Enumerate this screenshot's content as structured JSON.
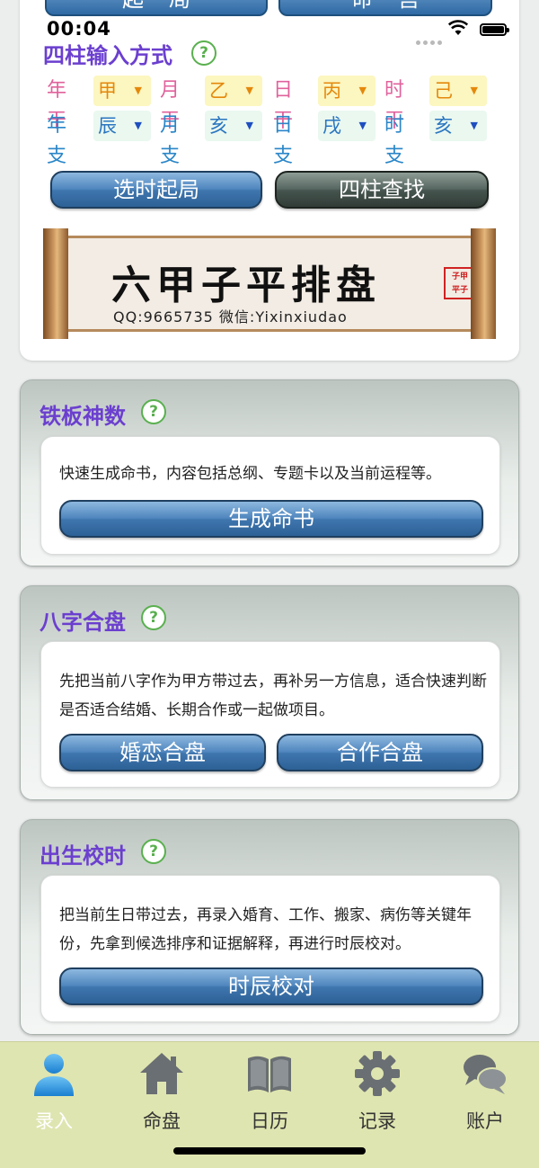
{
  "status_bar": {
    "time": "00:04"
  },
  "top_card": {
    "partial_buttons": [
      "起局",
      "命宫"
    ],
    "pillar_section_title": "四柱输入方式",
    "help_symbol": "?",
    "stems": [
      {
        "label": "年干",
        "value": "甲"
      },
      {
        "label": "月干",
        "value": "乙"
      },
      {
        "label": "日干",
        "value": "丙"
      },
      {
        "label": "时干",
        "value": "己"
      }
    ],
    "branches": [
      {
        "label": "年支",
        "value": "辰"
      },
      {
        "label": "月支",
        "value": "亥"
      },
      {
        "label": "日支",
        "value": "戌"
      },
      {
        "label": "时支",
        "value": "亥"
      }
    ],
    "dropdown_arrow": "▼",
    "select_time_button": "选时起局",
    "search_pillars_button": "四柱查找",
    "banner": {
      "title": "六甲子平排盘",
      "contact": "QQ:9665735  微信:Yixinxiudao",
      "seal_line1": "子甲",
      "seal_line2": "平子"
    }
  },
  "cards": [
    {
      "title": "铁板神数",
      "description": "快速生成命书，内容包括总纲、专题卡以及当前运程等。",
      "buttons": [
        "生成命书"
      ]
    },
    {
      "title": "八字合盘",
      "description": "先把当前八字作为甲方带过去，再补另一方信息，适合快速判断是否适合结婚、长期合作或一起做项目。",
      "buttons": [
        "婚恋合盘",
        "合作合盘"
      ]
    },
    {
      "title": "出生校时",
      "description": "把当前生日带过去，再录入婚育、工作、搬家、病伤等关键年份，先拿到候选排序和证据解释，再进行时辰校对。",
      "buttons": [
        "时辰校对"
      ]
    }
  ],
  "tab_bar": {
    "items": [
      {
        "label": "录入",
        "icon": "user-icon",
        "active": true
      },
      {
        "label": "命盘",
        "icon": "house-icon",
        "active": false
      },
      {
        "label": "日历",
        "icon": "book-icon",
        "active": false
      },
      {
        "label": "记录",
        "icon": "gear-icon",
        "active": false
      },
      {
        "label": "账户",
        "icon": "chat-bubbles-icon",
        "active": false
      }
    ]
  },
  "colors": {
    "accent_purple": "#6b3fcf",
    "stem_label": "#e0629c",
    "branch_label": "#2a86c8",
    "button_blue": "#3f76ae",
    "tab_bar_bg": "#dfe5b0"
  }
}
